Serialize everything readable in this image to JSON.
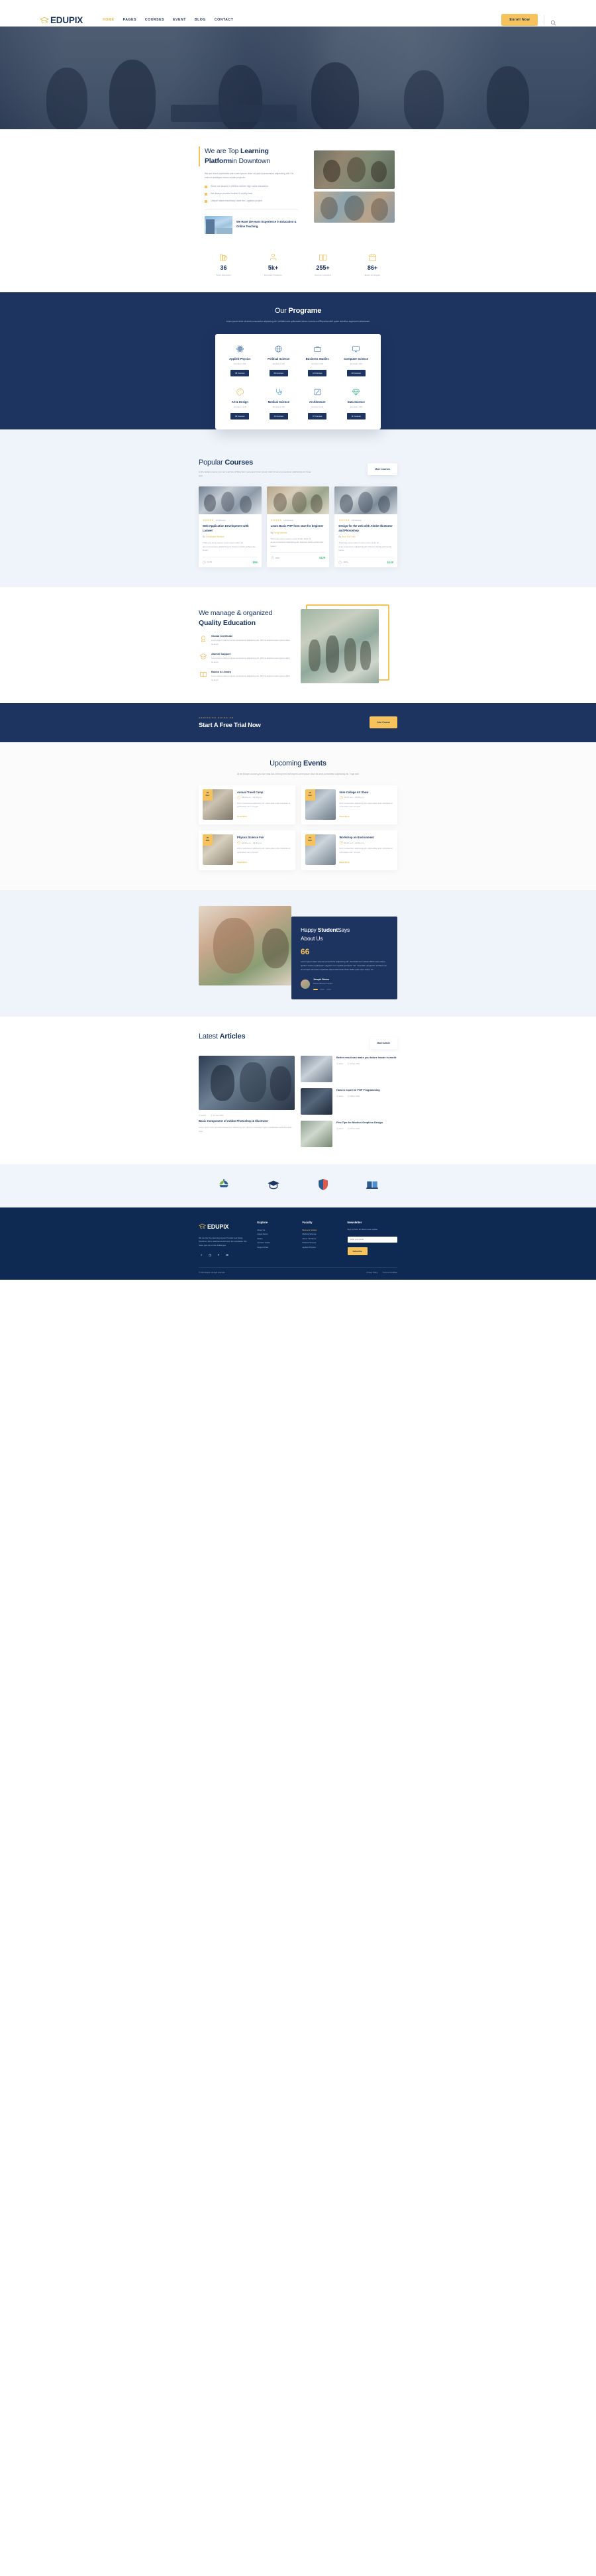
{
  "header": {
    "brand": "EDUPIX",
    "nav": [
      {
        "label": "HOME",
        "active": true
      },
      {
        "label": "PAGES",
        "active": false
      },
      {
        "label": "COURSES",
        "active": false
      },
      {
        "label": "EVENT",
        "active": false
      },
      {
        "label": "BLOG",
        "active": false
      },
      {
        "label": "CONTACT",
        "active": false
      }
    ],
    "enroll_label": "Enroll Now",
    "search_icon": "search-icon"
  },
  "about": {
    "title_plain_1": "We are Top ",
    "title_bold_1": "Learning",
    "title_bold_2": "Platform",
    "title_plain_2": "in Downtown",
    "desc": "We are teach worldwide site lorem ipsum dolor sit amet,consectetur adipisicing elit. Ea enim et,similique,minus solutio projects.",
    "bullets": [
      "Since our launch in 2005,to deliver high value education.",
      "We always provide flexible & quality task.",
      "Unique latest machinary used the Logistics project."
    ],
    "experience": "We Have 15+years Experience in Education & Online Teaching."
  },
  "stats": [
    {
      "icon": "books-icon",
      "value": "36",
      "label": "Total Faculties"
    },
    {
      "icon": "students-icon",
      "value": "5k+",
      "label": "Enrolled Students"
    },
    {
      "icon": "course-icon",
      "value": "255+",
      "label": "Course Included"
    },
    {
      "icon": "event-icon",
      "value": "86+",
      "label": "Event Arranged"
    }
  ],
  "program": {
    "title_plain": "Our ",
    "title_bold": "Programe",
    "subtitle": "Lorem ipsum dolor sit amet,consectetur adipisicing elit. Veritatis iusto quibusdam labore inventore et!Reprehenderit quam doloribus asperiores laboriosam.",
    "cards": [
      {
        "icon": "atom-icon",
        "name": "Applied Physics",
        "meta": "Enrolled 1 136",
        "button": "08 Courses"
      },
      {
        "icon": "globe-icon",
        "name": "Political Science",
        "meta": "Enrolled 1 182",
        "button": "06 Courses"
      },
      {
        "icon": "briefcase-icon",
        "name": "Business Studies",
        "meta": "Enrolled 1 206",
        "button": "12 Courses"
      },
      {
        "icon": "monitor-icon",
        "name": "Computer Science",
        "meta": "Enrolled 1 265",
        "button": "20 Courses"
      },
      {
        "icon": "palette-icon",
        "name": "Art & Design",
        "meta": "Enrolled 1 120",
        "button": "09 Courses"
      },
      {
        "icon": "stethoscope-icon",
        "name": "Medical Science",
        "meta": "Enrolled 1 165",
        "button": "14 Courses"
      },
      {
        "icon": "ruler-icon",
        "name": "Architecture",
        "meta": "Enrolled 1 142",
        "button": "07 Courses"
      },
      {
        "icon": "diamond-icon",
        "name": "Data Science",
        "meta": "Enrolled 1 198",
        "button": "11 Courses"
      }
    ]
  },
  "courses": {
    "title_plain": "Popular ",
    "title_bold": "Courses",
    "subtitle": "At the Edupix course you can read lots of thing form real expert lorem ipsum dolor sit amet,consectetur adipisicing elit. Fuga sed!",
    "more_label": "More Courses",
    "items": [
      {
        "stars": "★★★★★",
        "reviews": "176 Review",
        "title": "Web Application Development with Laravel",
        "by_prefix": "By ",
        "author": "Christopher Neilson",
        "desc": "There are some reason Lorem ipsum dolor sit amet,consectetur adipisicing elit. Dolorem,facilis perferendis ipsam.",
        "students": "1578",
        "price": "$99"
      },
      {
        "stars": "★★★★★",
        "reviews": "110 Review",
        "title": "Learn Basic PHP form start for beginner",
        "by_prefix": "By ",
        "author": "Ricky Marshal",
        "desc": "There are some reason Lorem ipsum dolor sit amet,consectetur adipisicing elit. Dolorem,facilis perferendis ipsam.",
        "students": "2087",
        "price": "$129"
      },
      {
        "stars": "★★★★★",
        "reviews": "242 Review",
        "title": "Design for the web with Adobe Illustrator and Photoshop",
        "by_prefix": "By ",
        "author": "Jhon Doe Kalli",
        "desc": "There are some reason Lorem ipsum dolor sit amet,consectetur adipisicing elit. Dolorem,facilis perferendis ipsam.",
        "students": "1824",
        "price": "$149"
      }
    ]
  },
  "quality": {
    "title_plain": "We manage & organized",
    "title_bold": "Quality Education",
    "items": [
      {
        "icon": "certificate-icon",
        "heading": "Global Certificate",
        "text": "Lorem ipsum dolor sit amet,consectetur adipisicing elit. Nihil at dele!Accusam ipsum dolor sit amet."
      },
      {
        "icon": "alumni-icon",
        "heading": "Alumni Support",
        "text": "Lorem ipsum dolor sit amet,consectetur adipisicing elit. Nihil at dele!Accusam ipsum dolor sit amet."
      },
      {
        "icon": "library-icon",
        "heading": "Books & Library",
        "text": "Lorem ipsum dolor sit amet,consectetur adipisicing elit. Nihil at dele!Accusam ipsum dolor sit amet."
      }
    ]
  },
  "cta": {
    "kicker": "ADMISSION GOING ON",
    "title": "Start A Free Trial Now",
    "button": "Join Course"
  },
  "events": {
    "title_plain": "Upcoming ",
    "title_bold": "Events",
    "subtitle": "At the Edupix courses you can read lots of thing form real expert Lorem ipsum dolor sit amet,consectetur adipisicing elit. Fuga sed!",
    "items": [
      {
        "day": "30",
        "month": "Dec",
        "title": "Annual Travel Camp",
        "time": "08.00 a.m. - 04.00 p.m.",
        "desc": "Enim consectetur adipisicing elit. natus,alias unde molestias at quibusdam nam corrupti!",
        "link": "Read More"
      },
      {
        "day": "18",
        "month": "Jan",
        "title": "Inter-College Art Show",
        "time": "09.00 a.m. - 05.00 p.m.",
        "desc": "Enim consectetur adipisicing elit. natus,alias unde molestias at quibusdam nam corrupti!",
        "link": "Read More"
      },
      {
        "day": "05",
        "month": "Feb",
        "title": "Physics Science Fair",
        "time": "10.00 a.m. - 03.00 p.m.",
        "desc": "Enim consectetur adipisicing elit. natus,alias unde molestias at quibusdam nam corrupti!",
        "link": "Read More"
      },
      {
        "day": "22",
        "month": "Feb",
        "title": "Workshop on Environment",
        "time": "08.30 a.m. - 02.00 p.m.",
        "desc": "Enim consectetur adipisicing elit. natus,alias unde molestias at quibusdam nam corrupti!",
        "link": "Read More"
      }
    ]
  },
  "testimonial": {
    "title_plain_1": "Happy ",
    "title_bold": "Student",
    "title_plain_2": "Says",
    "title_line2": "About Us",
    "quote_mark": "66",
    "text": "Lorem ipsum dolor sit amet,consectetur adipisicing elit. Exercitationem soluta officiis iusto saepe quidem maiores quisquam magnam rem repellat,quisquam iure molestias voluptatum similique ea sit,corrupti odit autem explicabo atque laboriosam!Sunt facilis quia culpa saepe sit!",
    "author": "Joseph Simon",
    "role": "Student,Boston Studies",
    "dots": 3
  },
  "articles": {
    "title_plain": "Latest ",
    "title_bold": "Articles",
    "more_label": "More Article",
    "main": {
      "admin": "admin",
      "date": "12 Nov 2021",
      "title": "Basic Component of Adobe Photoshop & Illustrator",
      "desc": "Lorem ipsum dolor sit amet,consectetur adipisicing elit. Laborum molestiae fugiat repudiandae explicabo quas vitae."
    },
    "side": [
      {
        "title": "Better result can make you future leader in world",
        "admin": "admin",
        "date": "10 Nov 2021"
      },
      {
        "title": "How to expert in PHP Programming",
        "admin": "admin",
        "date": "08 Nov 2021"
      },
      {
        "title": "Few Tips for Modern Graphics Design",
        "admin": "admin",
        "date": "05 Nov 2021"
      }
    ]
  },
  "brands": [
    {
      "icon": "brand-leaf-icon"
    },
    {
      "icon": "brand-cap-icon"
    },
    {
      "icon": "brand-shield-icon"
    },
    {
      "icon": "brand-book-icon"
    }
  ],
  "footer": {
    "brand": "EDUPIX",
    "desc": "We are the Top Learning Center Provider and Study Solutions. We're teaches around over the worldwide. We never give up on the challenges.",
    "social": [
      "facebook-icon",
      "instagram-icon",
      "twitter-icon",
      "behance-icon"
    ],
    "explore_heading": "Explore",
    "explore": [
      "About Us",
      "Latest News",
      "Notice",
      "Lecturer Guide",
      "Support Plan"
    ],
    "faculty_heading": "Faculty",
    "faculty": [
      "Business Studies",
      "Medical Science",
      "Arts & Literature",
      "Political Science",
      "Applied Physics"
    ],
    "newsletter_heading": "Newsletter",
    "newsletter_desc": "Sign up here for latest news update.",
    "newsletter_placeholder": "Enter your email",
    "newsletter_button": "Subscribe",
    "copyright": "© 2021 Edupix. All right reserved.",
    "links": [
      "Privacy Policy",
      "Terms & Condition"
    ]
  },
  "colors": {
    "navy": "#1d3461",
    "navy_dark": "#0f2a52",
    "yellow": "#f5c25b",
    "yellow_text": "#f0b844",
    "green": "#3cc47c",
    "light": "#eef4f9"
  }
}
